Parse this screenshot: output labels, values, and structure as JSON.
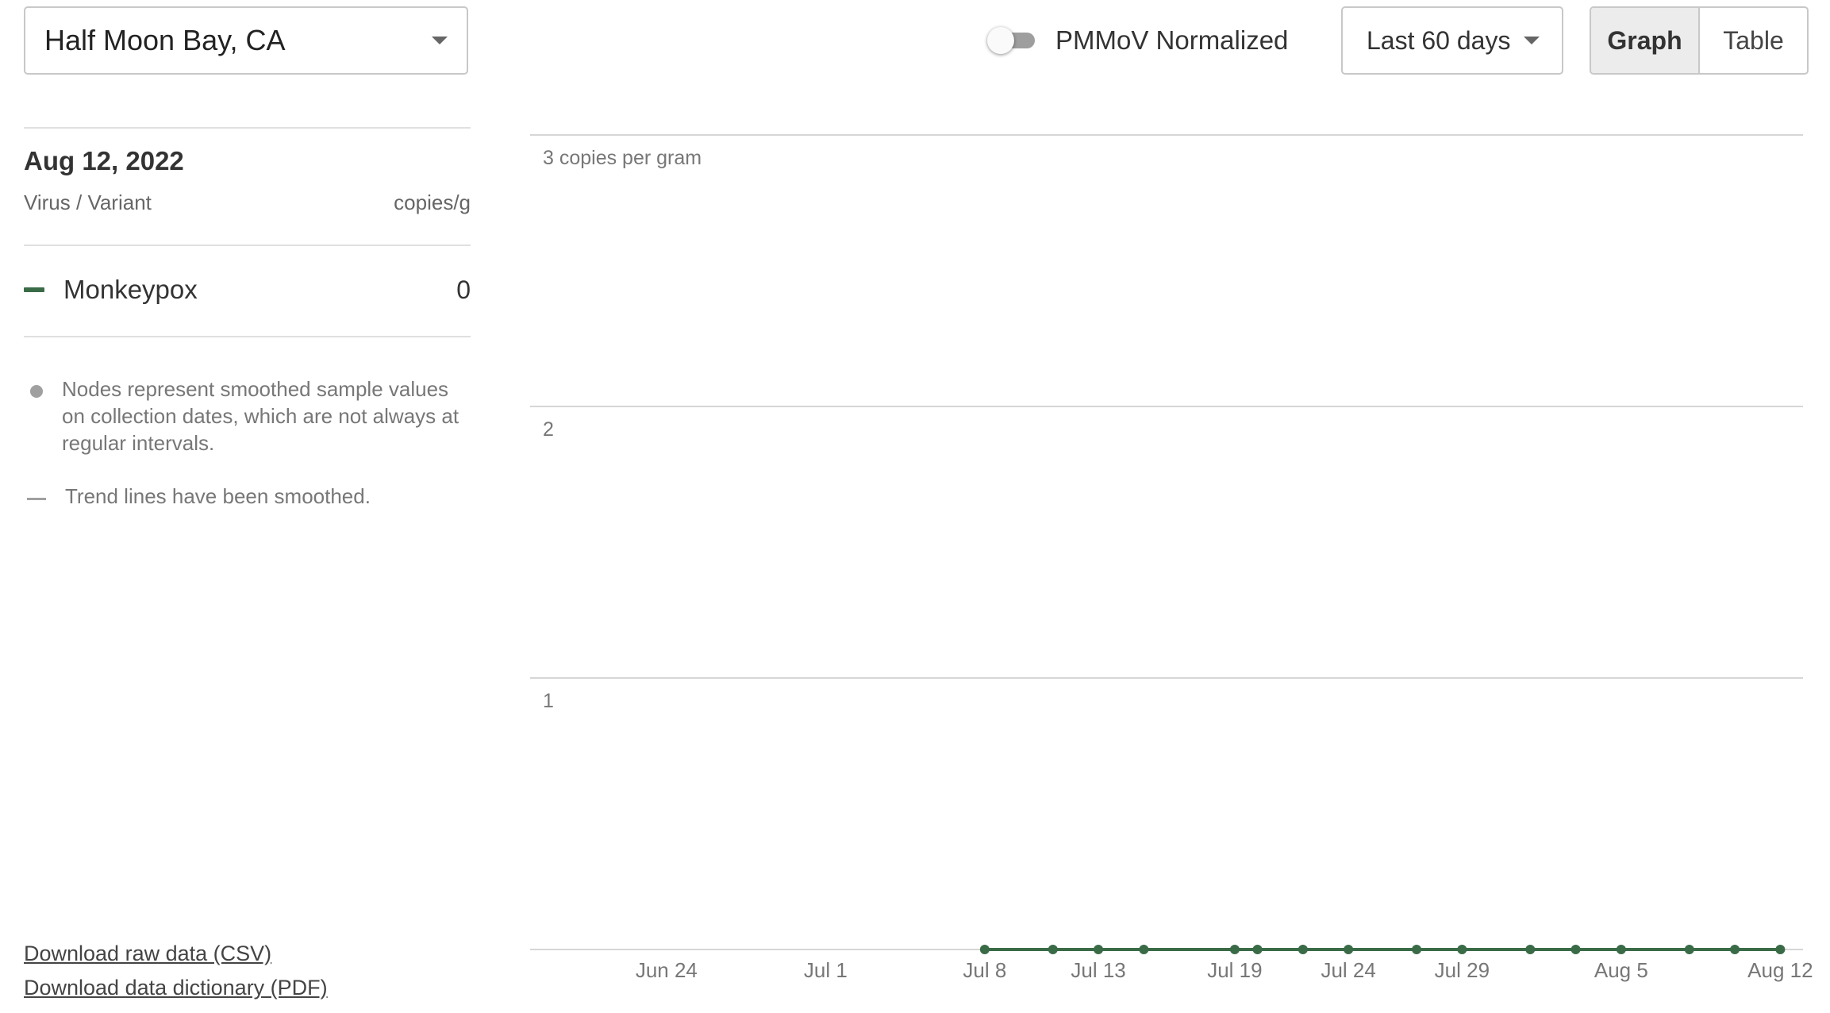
{
  "controls": {
    "location": "Half Moon Bay, CA",
    "pmmov_label": "PMMoV Normalized",
    "pmmov_on": false,
    "range": "Last 60 days",
    "view_graph": "Graph",
    "view_table": "Table",
    "active_view": "Graph"
  },
  "panel": {
    "date": "Aug 12, 2022",
    "col_left": "Virus / Variant",
    "col_right": "copies/g",
    "series_name": "Monkeypox",
    "series_value": "0",
    "notes": [
      "Nodes represent smoothed sample values on collection dates, which are not always at regular intervals.",
      "Trend lines have been smoothed."
    ],
    "downloads": [
      "Download raw data (CSV)",
      "Download data dictionary (PDF)"
    ]
  },
  "colors": {
    "series": "#3a6b47",
    "grid": "#d6d6d6"
  },
  "chart_data": {
    "type": "line",
    "ylim": [
      0,
      3
    ],
    "y_ticks": [
      {
        "value": 3,
        "label": "3 copies per gram"
      },
      {
        "value": 2,
        "label": "2"
      },
      {
        "value": 1,
        "label": "1"
      }
    ],
    "x_range": [
      "2022-06-18",
      "2022-08-13"
    ],
    "x_ticks": [
      {
        "date": "2022-06-24",
        "label": "Jun 24"
      },
      {
        "date": "2022-07-01",
        "label": "Jul 1"
      },
      {
        "date": "2022-07-08",
        "label": "Jul 8"
      },
      {
        "date": "2022-07-13",
        "label": "Jul 13"
      },
      {
        "date": "2022-07-19",
        "label": "Jul 19"
      },
      {
        "date": "2022-07-24",
        "label": "Jul 24"
      },
      {
        "date": "2022-07-29",
        "label": "Jul 29"
      },
      {
        "date": "2022-08-05",
        "label": "Aug 5"
      },
      {
        "date": "2022-08-12",
        "label": "Aug 12"
      }
    ],
    "series": [
      {
        "name": "Monkeypox",
        "points": [
          {
            "x": "2022-07-08",
            "y": 0
          },
          {
            "x": "2022-07-11",
            "y": 0
          },
          {
            "x": "2022-07-13",
            "y": 0
          },
          {
            "x": "2022-07-15",
            "y": 0
          },
          {
            "x": "2022-07-19",
            "y": 0
          },
          {
            "x": "2022-07-20",
            "y": 0
          },
          {
            "x": "2022-07-22",
            "y": 0
          },
          {
            "x": "2022-07-24",
            "y": 0
          },
          {
            "x": "2022-07-27",
            "y": 0
          },
          {
            "x": "2022-07-29",
            "y": 0
          },
          {
            "x": "2022-08-01",
            "y": 0
          },
          {
            "x": "2022-08-03",
            "y": 0
          },
          {
            "x": "2022-08-05",
            "y": 0
          },
          {
            "x": "2022-08-08",
            "y": 0
          },
          {
            "x": "2022-08-10",
            "y": 0
          },
          {
            "x": "2022-08-12",
            "y": 0
          }
        ]
      }
    ]
  }
}
